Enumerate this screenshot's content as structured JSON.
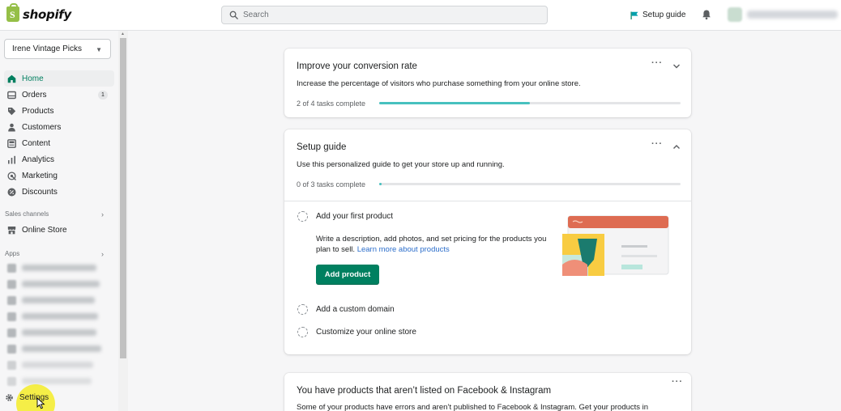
{
  "topbar": {
    "brand": "shopify",
    "logo_letter": "S",
    "search_placeholder": "Search",
    "setup_guide_label": "Setup guide"
  },
  "sidebar": {
    "store_name": "Irene Vintage Picks",
    "nav": [
      {
        "label": "Home",
        "icon": "home-icon",
        "active": true
      },
      {
        "label": "Orders",
        "icon": "orders-icon",
        "badge": "1"
      },
      {
        "label": "Products",
        "icon": "tag-icon"
      },
      {
        "label": "Customers",
        "icon": "person-icon"
      },
      {
        "label": "Content",
        "icon": "content-icon"
      },
      {
        "label": "Analytics",
        "icon": "bar-chart-icon"
      },
      {
        "label": "Marketing",
        "icon": "target-icon"
      },
      {
        "label": "Discounts",
        "icon": "discount-icon"
      }
    ],
    "sales_channels_label": "Sales channels",
    "online_store_label": "Online Store",
    "apps_label": "Apps",
    "settings_label": "Settings"
  },
  "cards": {
    "conversion": {
      "title": "Improve your conversion rate",
      "description": "Increase the percentage of visitors who purchase something from your online store.",
      "progress_label": "2 of 4 tasks complete",
      "progress": 0.5
    },
    "setup": {
      "title": "Setup guide",
      "description": "Use this personalized guide to get your store up and running.",
      "progress_label": "0 of 3 tasks complete",
      "progress": 0.0,
      "tasks": [
        {
          "label": "Add your first product"
        },
        {
          "label": "Add a custom domain"
        },
        {
          "label": "Customize your online store"
        }
      ],
      "task_description": "Write a description, add photos, and set pricing for the products you plan to sell.",
      "learn_more_link": "Learn more about products",
      "add_product_label": "Add product"
    },
    "facebook": {
      "title": "You have products that aren’t listed on Facebook & Instagram",
      "description": "Some of your products have errors and aren’t published to Facebook & Instagram. Get your products in"
    }
  },
  "colors": {
    "accent_green": "#008060",
    "progress_teal": "#47c1bf",
    "link_blue": "#2c6ecb",
    "shopify_green": "#95bf47"
  }
}
